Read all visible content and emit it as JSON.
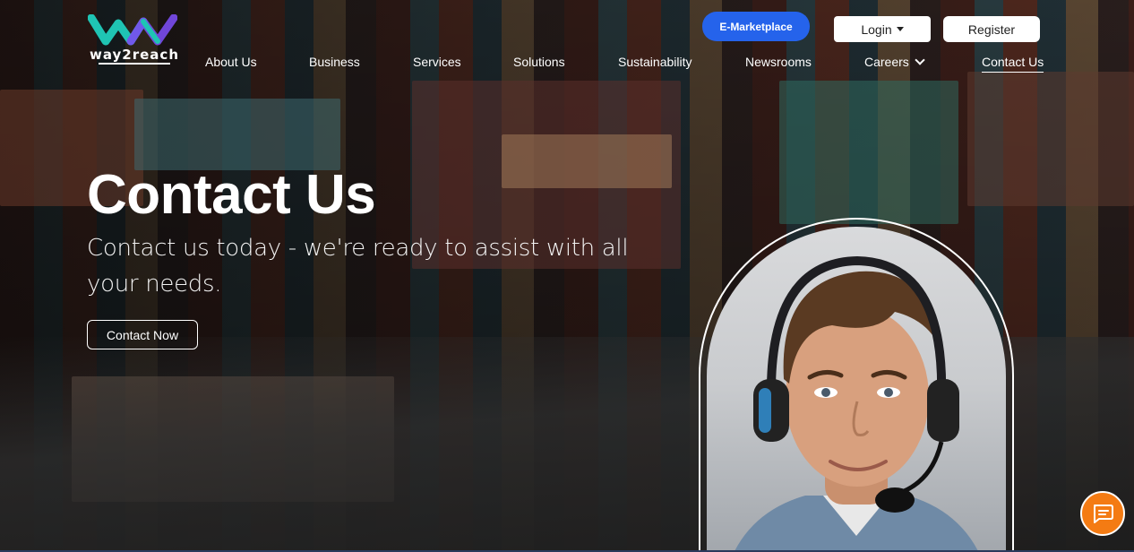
{
  "brand": {
    "name": "way2reach",
    "colors": {
      "logo_teal": "#1fc4b4",
      "logo_purple": "#7a4df0",
      "accent_blue": "#2563eb",
      "chat_orange": "#f47b13"
    }
  },
  "header": {
    "emarketplace_label": "E-Marketplace",
    "login_label": "Login",
    "register_label": "Register"
  },
  "nav": {
    "items": [
      {
        "label": "About Us"
      },
      {
        "label": "Business"
      },
      {
        "label": "Services"
      },
      {
        "label": "Solutions"
      },
      {
        "label": "Sustainability"
      },
      {
        "label": "Newsrooms"
      },
      {
        "label": "Careers",
        "has_dropdown": true
      },
      {
        "label": "Contact Us",
        "active": true
      }
    ]
  },
  "hero": {
    "title": "Contact Us",
    "subtitle": "Contact us today - we're ready to assist with all your needs.",
    "cta_label": "Contact Now"
  },
  "icons": {
    "chat": "chat-icon",
    "dropdown": "chevron-down-icon",
    "caret": "caret-down-icon"
  }
}
